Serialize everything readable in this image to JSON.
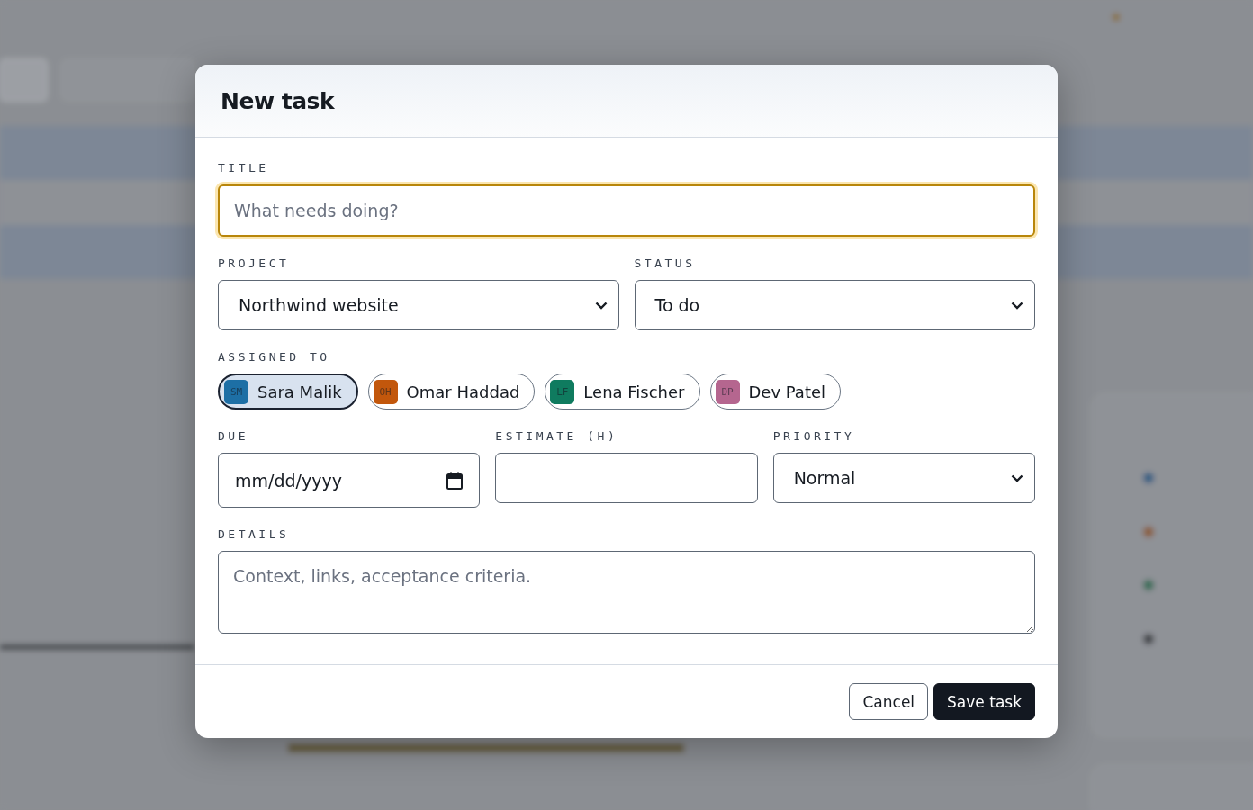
{
  "dialog": {
    "title": "New task",
    "fields": [
      {
        "kind": "text",
        "label": "TITLE",
        "placeholder": "What needs doing?",
        "focused": true
      },
      {
        "kind": "select",
        "label": "PROJECT",
        "value": "Northwind website"
      },
      {
        "kind": "select",
        "label": "STATUS",
        "value": "To do"
      },
      {
        "kind": "people",
        "label": "ASSIGNED TO",
        "people": [
          {
            "initials": "SM",
            "name": "Sara Malik",
            "color": "#1d6fa5",
            "selected": true
          },
          {
            "initials": "OH",
            "name": "Omar Haddad",
            "color": "#c2570c",
            "selected": false
          },
          {
            "initials": "LF",
            "name": "Lena Fischer",
            "color": "#0f7b5f",
            "selected": false
          },
          {
            "initials": "DP",
            "name": "Dev Patel",
            "color": "#b5668f",
            "selected": false
          }
        ]
      },
      {
        "kind": "date",
        "label": "DUE",
        "placeholder": "mm/dd/yyyy"
      },
      {
        "kind": "number",
        "label": "ESTIMATE (H)"
      },
      {
        "kind": "select",
        "label": "PRIORITY",
        "value": "Normal"
      },
      {
        "kind": "textarea",
        "label": "DETAILS",
        "placeholder": "Context, links, acceptance criteria."
      }
    ],
    "buttons": [
      {
        "label": "Cancel",
        "kind": "secondary"
      },
      {
        "label": "Save task",
        "kind": "primary"
      }
    ]
  }
}
